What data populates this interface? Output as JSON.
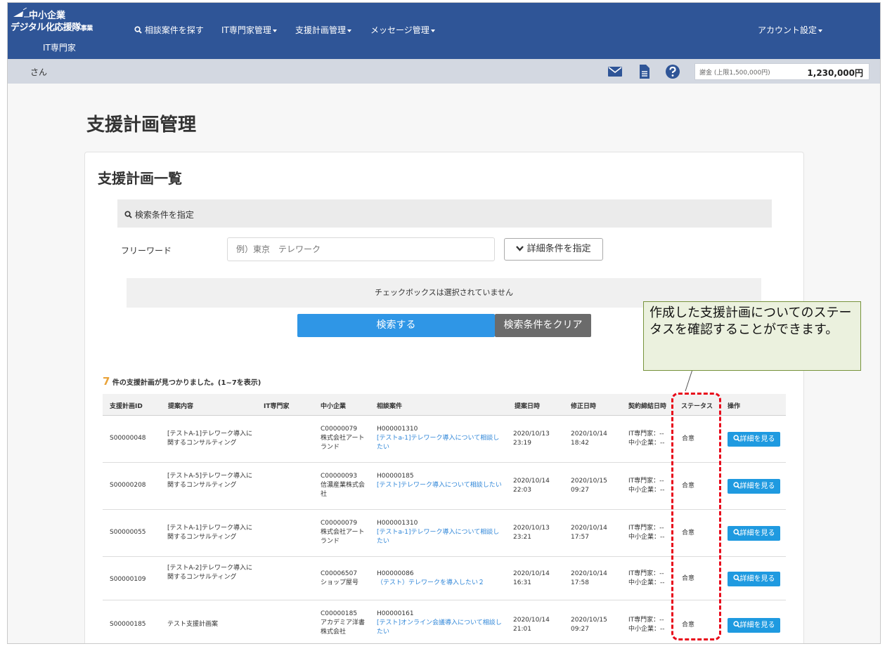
{
  "header": {
    "logo_line1": "中小企業",
    "logo_line2": "デジタル化応援隊",
    "logo_line2_suffix": "事業",
    "logo_role": "IT専門家",
    "nav": [
      {
        "label": "相談案件を探す",
        "icon": "search-icon"
      },
      {
        "label": "IT専門家管理",
        "dropdown": true
      },
      {
        "label": "支援計画管理",
        "dropdown": true
      },
      {
        "label": "メッセージ管理",
        "dropdown": true
      }
    ],
    "account": "アカウント設定"
  },
  "subbar": {
    "user_suffix": "さん",
    "icons": [
      "mail-icon",
      "document-icon",
      "help-icon"
    ],
    "balance_label": "謝金 (上限1,500,000円)",
    "balance_value": "1,230,000円"
  },
  "page_title": "支援計画管理",
  "card_title": "支援計画一覧",
  "search": {
    "header": "検索条件を指定",
    "freeword_label": "フリーワード",
    "freeword_placeholder": "例）東京　テレワーク",
    "detail_button": "詳細条件を指定",
    "checkbox_message": "チェックボックスは選択されていません",
    "search_button": "検索する",
    "clear_button": "検索条件をクリア"
  },
  "results": {
    "count": "7",
    "count_text": "件の支援計画が見つかりました。(1~7を表示)"
  },
  "table": {
    "headers": [
      "支援計画ID",
      "提案内容",
      "IT専門家",
      "中小企業",
      "相談案件",
      "提案日時",
      "修正日時",
      "契約締結日時",
      "ステータス",
      "操作"
    ],
    "detail_label": "詳細を見る",
    "rows": [
      {
        "id": "S00000048",
        "proposal": "[テストA-1]テレワーク導入に関するコンサルティング",
        "it_expert": "",
        "company_code": "C00000079",
        "company_name": "株式会社アートランド",
        "case_id": "H000001310",
        "case_title": "[テストa-1]テレワーク導入について相談したい",
        "proposed": "2020/10/13 23:19",
        "modified": "2020/10/14 18:42",
        "contract_it": "IT専門家：--",
        "contract_sme": "中小企業：--",
        "status": "合意"
      },
      {
        "id": "S00000208",
        "proposal": "[テストA-5]テレワーク導入に関するコンサルティング",
        "it_expert": "",
        "company_code": "C00000093",
        "company_name": "信濃産業株式会社",
        "case_id": "H00000185",
        "case_title": "[テスト]テレワーク導入について相談したい",
        "proposed": "2020/10/14 22:03",
        "modified": "2020/10/15 09:27",
        "contract_it": "IT専門家：--",
        "contract_sme": "中小企業：--",
        "status": "合意"
      },
      {
        "id": "S00000055",
        "proposal": "[テストA-1]テレワーク導入に関するコンサルティング",
        "it_expert": "",
        "company_code": "C00000079",
        "company_name": "株式会社アートランド",
        "case_id": "H000001310",
        "case_title": "[テストa-1]テレワーク導入について相談したい",
        "proposed": "2020/10/13 23:21",
        "modified": "2020/10/14 17:57",
        "contract_it": "IT専門家：--",
        "contract_sme": "中小企業：--",
        "status": "合意"
      },
      {
        "id": "S00000109",
        "proposal": "[テストA-2]テレワーク導入に関するコンサルティング",
        "it_expert": "",
        "company_code": "C00006507",
        "company_name": "ショップ屋号",
        "case_id": "H00000086",
        "case_title": "（テスト）テレワークを導入したい２",
        "proposed": "2020/10/14 16:31",
        "modified": "2020/10/14 17:58",
        "contract_it": "IT専門家：--",
        "contract_sme": "中小企業：--",
        "status": "合意"
      },
      {
        "id": "S00000185",
        "proposal": "テスト支援計画案",
        "it_expert": "",
        "company_code": "C00000185",
        "company_name": "アカデミア洋書株式会社",
        "case_id": "H00000161",
        "case_title": "[テスト]オンライン会議導入について相談したい",
        "proposed": "2020/10/14 21:01",
        "modified": "2020/10/15 09:27",
        "contract_it": "IT専門家：--",
        "contract_sme": "中小企業：--",
        "status": "合意"
      }
    ]
  },
  "callout": {
    "text": "作成した支援計画についてのステータスを確認することができます。"
  },
  "colors": {
    "navbar": "#2f5597",
    "accent_blue": "#2f96e6",
    "callout_bg": "#ebf1de",
    "highlight_red": "#e8081a"
  }
}
